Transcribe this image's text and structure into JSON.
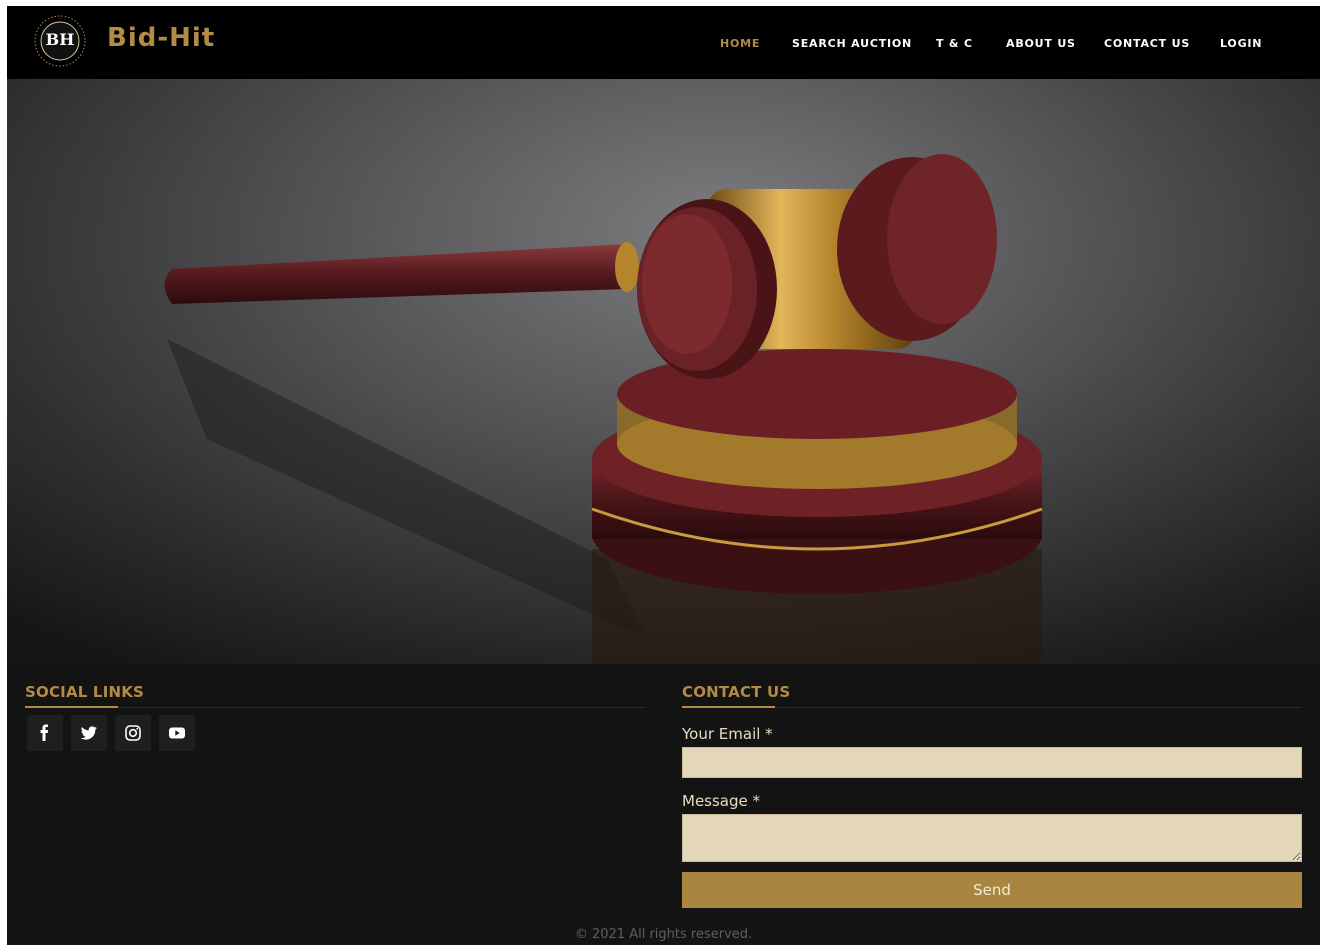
{
  "brand": {
    "logo_text": "BH",
    "name": "Bid-Hit",
    "accent_color": "#b38b45"
  },
  "nav": {
    "items": [
      {
        "label": "HOME",
        "active": true
      },
      {
        "label": "SEARCH AUCTION",
        "active": false
      },
      {
        "label": "T & C",
        "active": false
      },
      {
        "label": "ABOUT US",
        "active": false
      },
      {
        "label": "CONTACT US",
        "active": false
      },
      {
        "label": "LOGIN",
        "active": false
      }
    ]
  },
  "hero": {
    "image": "auction-gavel-on-sound-block"
  },
  "social": {
    "title": "SOCIAL LINKS",
    "icons": [
      "facebook-icon",
      "twitter-icon",
      "instagram-icon",
      "youtube-icon"
    ]
  },
  "contact": {
    "title": "CONTACT US",
    "email_label": "Your Email *",
    "email_value": "",
    "message_label": "Message *",
    "message_value": "",
    "send_label": "Send"
  },
  "footer": {
    "copyright": "© 2021 All rights reserved."
  }
}
